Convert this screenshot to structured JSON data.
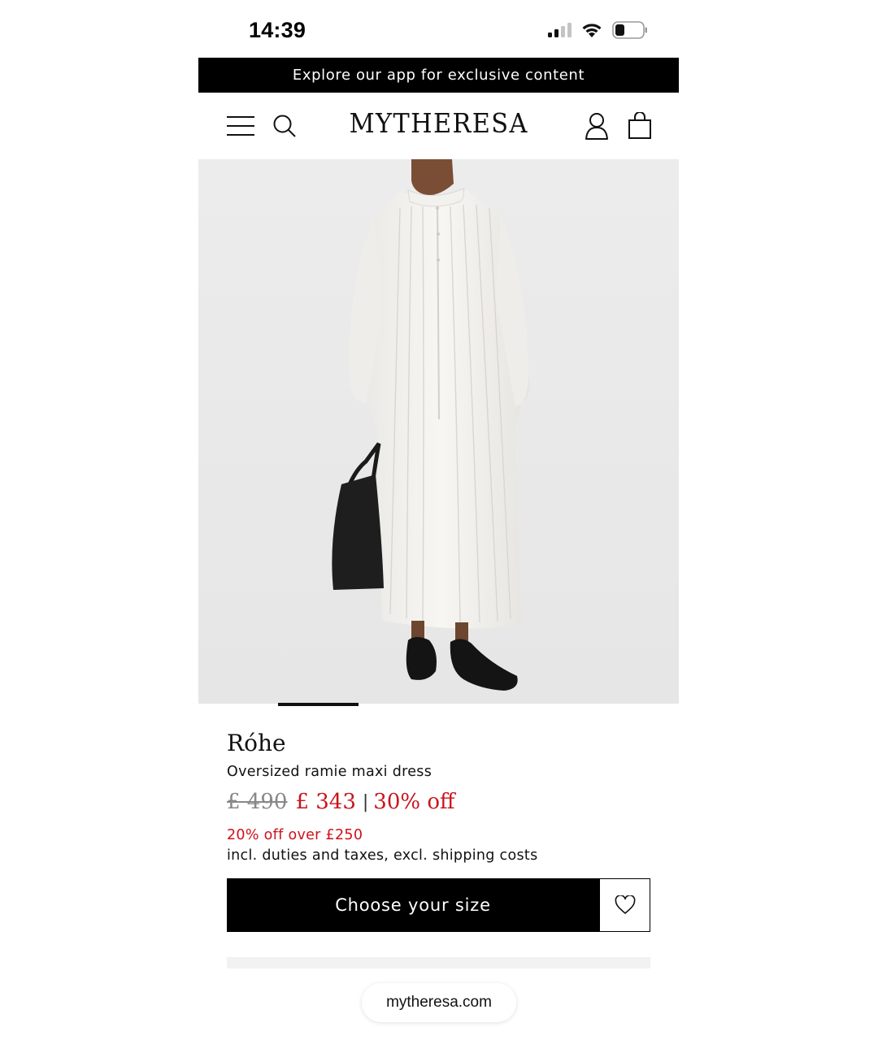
{
  "status_bar": {
    "time": "14:39"
  },
  "promo_banner": {
    "text": "Explore our app for exclusive content"
  },
  "header": {
    "logo": "MYTHERESA"
  },
  "product": {
    "brand": "Róhe",
    "name": "Oversized ramie maxi dress",
    "original_price": "£ 490",
    "sale_price": "£ 343",
    "separator": "|",
    "discount": "30% off",
    "promo_note": "20% off over £250",
    "tax_note": "incl. duties and taxes, excl. shipping costs"
  },
  "actions": {
    "choose_size_label": "Choose your size"
  },
  "browser": {
    "url": "mytheresa.com"
  },
  "colors": {
    "accent_red": "#c8161d",
    "black": "#000000",
    "image_bg": "#ececec"
  },
  "icons": [
    "signal-icon",
    "wifi-icon",
    "battery-icon",
    "menu-icon",
    "search-icon",
    "account-icon",
    "bag-icon",
    "heart-icon"
  ]
}
